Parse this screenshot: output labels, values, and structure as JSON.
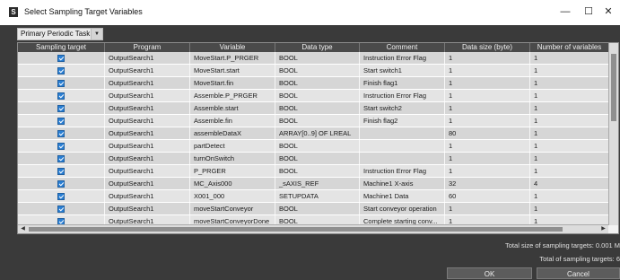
{
  "window": {
    "title": "Select Sampling Target Variables",
    "minimize_glyph": "—",
    "maximize_glyph": "☐",
    "close_glyph": "✕"
  },
  "task_selector": {
    "value": "Primary Periodic Task",
    "arrow_glyph": "▼"
  },
  "table": {
    "columns": [
      "Sampling target",
      "Program",
      "Variable",
      "Data type",
      "Comment",
      "Data size (byte)",
      "Number of variables"
    ],
    "rows": [
      {
        "checked": true,
        "program": "OutputSearch1",
        "variable": "MoveStart.P_PRGER",
        "data_type": "BOOL",
        "comment": "Instruction Error Flag",
        "size": "1",
        "count": "1"
      },
      {
        "checked": true,
        "program": "OutputSearch1",
        "variable": "MoveStart.start",
        "data_type": "BOOL",
        "comment": "Start switch1",
        "size": "1",
        "count": "1"
      },
      {
        "checked": true,
        "program": "OutputSearch1",
        "variable": "MoveStart.fin",
        "data_type": "BOOL",
        "comment": "Finish flag1",
        "size": "1",
        "count": "1"
      },
      {
        "checked": true,
        "program": "OutputSearch1",
        "variable": "Assemble.P_PRGER",
        "data_type": "BOOL",
        "comment": "Instruction Error Flag",
        "size": "1",
        "count": "1"
      },
      {
        "checked": true,
        "program": "OutputSearch1",
        "variable": "Assemble.start",
        "data_type": "BOOL",
        "comment": "Start switch2",
        "size": "1",
        "count": "1"
      },
      {
        "checked": true,
        "program": "OutputSearch1",
        "variable": "Assemble.fin",
        "data_type": "BOOL",
        "comment": "Finish flag2",
        "size": "1",
        "count": "1"
      },
      {
        "checked": true,
        "program": "OutputSearch1",
        "variable": "assembleDataX",
        "data_type": "ARRAY[0..9] OF LREAL",
        "comment": "",
        "size": "80",
        "count": "1"
      },
      {
        "checked": true,
        "program": "OutputSearch1",
        "variable": "partDetect",
        "data_type": "BOOL",
        "comment": "",
        "size": "1",
        "count": "1"
      },
      {
        "checked": true,
        "program": "OutputSearch1",
        "variable": "turnOnSwitch",
        "data_type": "BOOL",
        "comment": "",
        "size": "1",
        "count": "1"
      },
      {
        "checked": true,
        "program": "OutputSearch1",
        "variable": "P_PRGER",
        "data_type": "BOOL",
        "comment": "Instruction Error Flag",
        "size": "1",
        "count": "1"
      },
      {
        "checked": true,
        "program": "OutputSearch1",
        "variable": "MC_Axis000",
        "data_type": "_sAXIS_REF",
        "comment": "Machine1 X-axis",
        "size": "32",
        "count": "4"
      },
      {
        "checked": true,
        "program": "OutputSearch1",
        "variable": "X001_000",
        "data_type": "SETUPDATA",
        "comment": "Machine1 Data",
        "size": "60",
        "count": "1"
      },
      {
        "checked": true,
        "program": "OutputSearch1",
        "variable": "moveStartConveyor",
        "data_type": "BOOL",
        "comment": "Start conveyor operation",
        "size": "1",
        "count": "1"
      },
      {
        "checked": true,
        "program": "OutputSearch1",
        "variable": "moveStartConveyorDone",
        "data_type": "BOOL",
        "comment": "Complete starting conv...",
        "size": "1",
        "count": "1"
      }
    ]
  },
  "summary": {
    "total_size": "Total size of sampling targets: 0.001 M",
    "total_count": "Total of sampling targets: 6"
  },
  "buttons": {
    "ok": "OK",
    "cancel": "Cancel"
  },
  "scroll_arrows": {
    "left": "◀",
    "right": "▶"
  }
}
